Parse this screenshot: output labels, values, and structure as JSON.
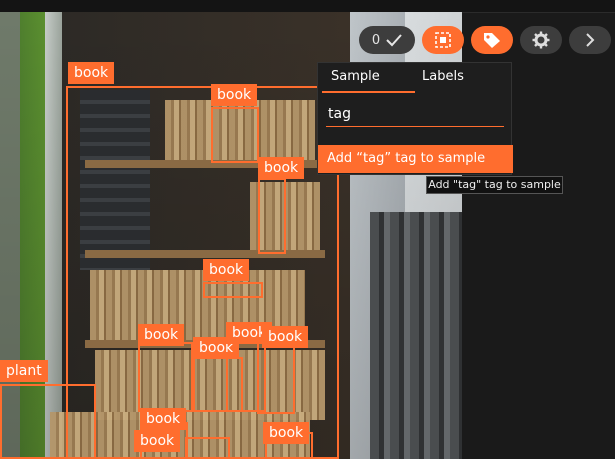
{
  "toolbar": {
    "count": "0",
    "check_icon": "check-icon",
    "buttons": [
      "select-icon",
      "tag-icon",
      "gear-icon",
      "chevron-right-icon"
    ],
    "accent": "#ff6d2e"
  },
  "tag_panel": {
    "tabs": [
      {
        "label": "Sample",
        "active": true
      },
      {
        "label": "Labels",
        "active": false
      }
    ],
    "input_value": "tag",
    "add_action": "Add “tag” tag to sample",
    "tooltip": "Add \"tag\" tag to sample"
  },
  "detections": [
    {
      "label": "book"
    },
    {
      "label": "book"
    },
    {
      "label": "book"
    },
    {
      "label": "book"
    },
    {
      "label": "book"
    },
    {
      "label": "book"
    },
    {
      "label": "book"
    },
    {
      "label": "book"
    },
    {
      "label": "plant"
    },
    {
      "label": "book"
    },
    {
      "label": "book"
    },
    {
      "label": "book"
    }
  ]
}
